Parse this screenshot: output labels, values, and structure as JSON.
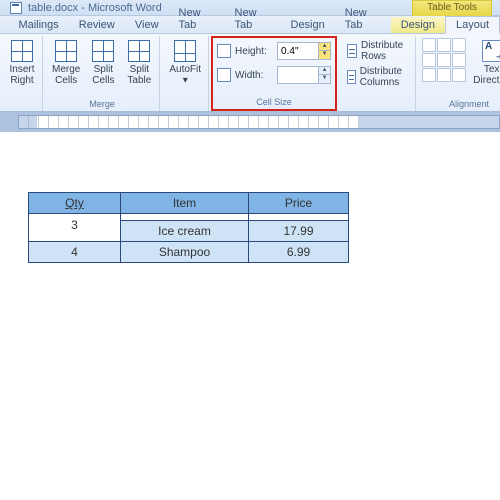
{
  "window": {
    "doc_title": "table.docx",
    "app": "Microsoft Word"
  },
  "table_tools_label": "Table Tools",
  "tabs": {
    "mailings": "Mailings",
    "review": "Review",
    "view": "View",
    "new_tab1": "New Tab",
    "new_tab2": "New Tab",
    "design_main": "Design",
    "new_tab3": "New Tab",
    "design_ctx": "Design",
    "layout": "Layout"
  },
  "ribbon": {
    "insert_right": "Insert\nRight",
    "merge_cells": "Merge\nCells",
    "split_cells": "Split\nCells",
    "split_table": "Split\nTable",
    "merge_group": "Merge",
    "autofit": "AutoFit",
    "cell_size": {
      "height_label": "Height:",
      "width_label": "Width:",
      "height_value": "0.4\"",
      "width_value": "",
      "group_label": "Cell Size"
    },
    "distribute_rows": "Distribute Rows",
    "distribute_columns": "Distribute Columns",
    "text_direction": "Text\nDirection",
    "alignment_group": "Alignment"
  },
  "doc_table": {
    "headers": {
      "qty": "Qty",
      "item": "Item",
      "price": "Price"
    },
    "rows": [
      {
        "qty": "3",
        "item": "Ice cream",
        "price": "17.99"
      },
      {
        "qty": "4",
        "item": "Shampoo",
        "price": "6.99"
      }
    ]
  }
}
